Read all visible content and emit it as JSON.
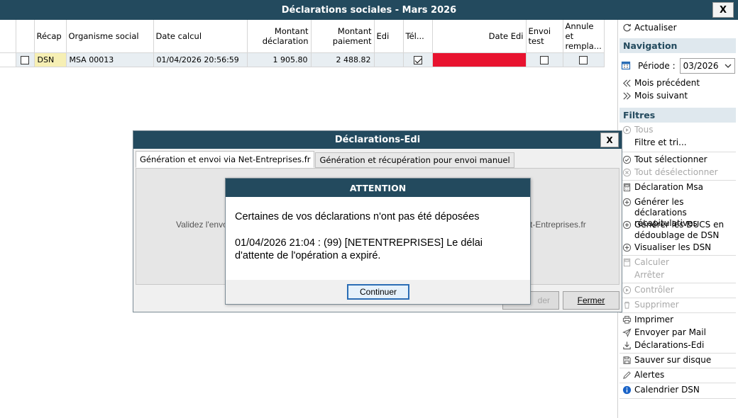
{
  "window": {
    "title": "Déclarations sociales - Mars 2026",
    "close_label": "X"
  },
  "grid": {
    "headers": {
      "recap": "Récap",
      "organisme": "Organisme social",
      "date_calcul": "Date calcul",
      "montant_decl": "Montant déclaration",
      "montant_paie": "Montant paiement",
      "edi": "Edi",
      "tele": "Tél...",
      "date_edi": "Date Edi",
      "envoi_test": "Envoi test",
      "annule": "Annule et rempla..."
    },
    "rows": [
      {
        "checked": false,
        "recap": "DSN",
        "organisme": "MSA 00013",
        "date_calcul": "01/04/2026 20:56:59",
        "montant_decl": "1 905.80",
        "montant_paie": "2 488.82",
        "edi": "",
        "tele": true,
        "date_edi": "",
        "envoi_test": false,
        "annule": false
      }
    ]
  },
  "sidebar": {
    "actualiser": "Actualiser",
    "nav_header": "Navigation",
    "periode_label": "Période :",
    "periode_value": "03/2026",
    "mois_precedent": "Mois précédent",
    "mois_suivant": "Mois suivant",
    "filtres_header": "Filtres",
    "tous": "Tous",
    "filtre_tri": "Filtre et tri...",
    "tout_selectionner": "Tout sélectionner",
    "tout_deselectionner": "Tout désélectionner",
    "declaration_msa": "Déclaration Msa",
    "generer_recap": "Générer les déclarations récapitulatives",
    "generer_ducs": "Générer les DUCS en dédoublage de DSN",
    "visualiser_dsn": "Visualiser les DSN",
    "calculer": "Calculer",
    "arreter": "Arrêter",
    "controler": "Contrôler",
    "supprimer": "Supprimer",
    "imprimer": "Imprimer",
    "envoyer_mail": "Envoyer par Mail",
    "declarations_edi": "Déclarations-Edi",
    "sauver_disque": "Sauver sur disque",
    "alertes": "Alertes",
    "calendrier_dsn": "Calendrier DSN"
  },
  "edi_dialog": {
    "title": "Déclarations-Edi",
    "close_label": "X",
    "tab1": "Génération et envoi via Net-Entreprises.fr",
    "tab2": "Génération et récupération pour envoi manuel",
    "panel_left_text": "Validez l'envoi",
    "panel_right_text": "t-Entreprises.fr",
    "btn_valider": "der",
    "btn_fermer": "Fermer"
  },
  "attention_dialog": {
    "title": "ATTENTION",
    "message1": "Certaines de vos déclarations n'ont pas été déposées",
    "message2": "01/04/2026 21:04 : (99) [NETENTREPRISES] Le délai d'attente de l'opération a expiré.",
    "button": "Continuer"
  },
  "colors": {
    "titlebar": "#234a5e",
    "row_bg": "#e8eef2",
    "recap_bg": "#f6efb4",
    "date_edi_bg": "#e8132f"
  }
}
